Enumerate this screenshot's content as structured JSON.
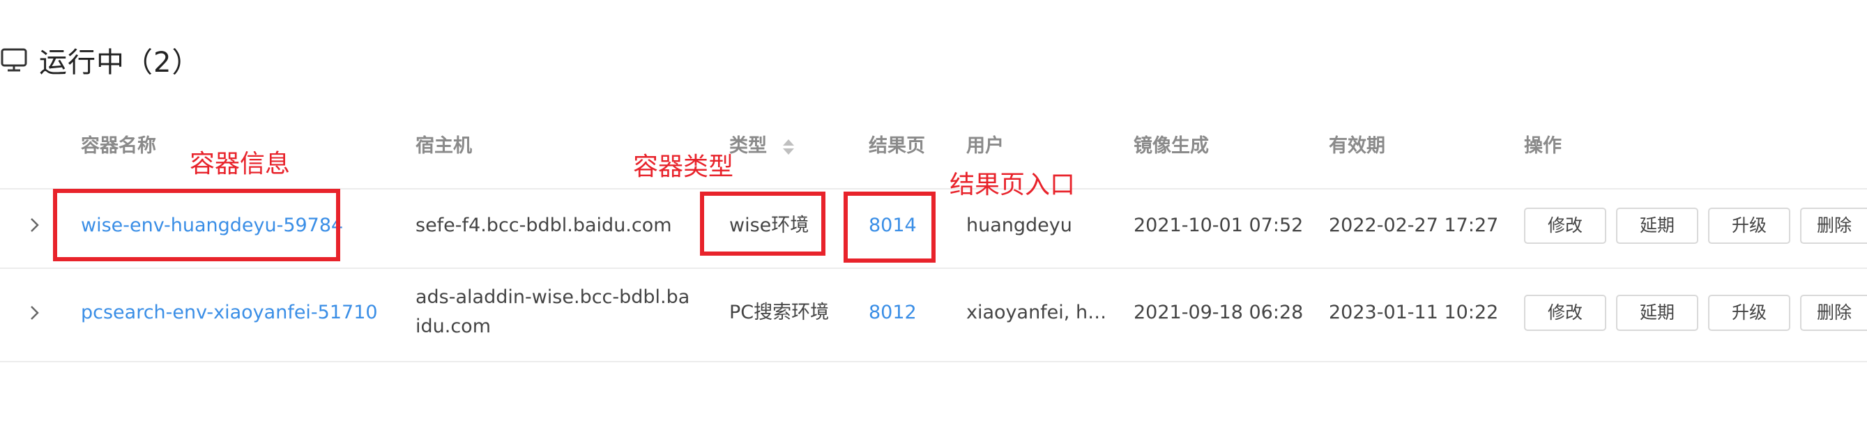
{
  "section": {
    "title": "运行中（2）",
    "icon": "monitor-icon"
  },
  "columns": {
    "name": "容器名称",
    "host": "宿主机",
    "type": "类型",
    "result": "结果页",
    "user": "用户",
    "image": "镜像生成",
    "expire": "有效期",
    "actions": "操作"
  },
  "rows": [
    {
      "name": "wise-env-huangdeyu-59784",
      "host": "sefe-f4.bcc-bdbl.baidu.com",
      "type": "wise环境",
      "result": "8014",
      "user": "huangdeyu",
      "image": "2021-10-01 07:52",
      "expire": "2022-02-27 17:27"
    },
    {
      "name": "pcsearch-env-xiaoyanfei-51710",
      "host": "ads-aladdin-wise.bcc-bdbl.baidu.com",
      "type": "PC搜索环境",
      "result": "8012",
      "user": "xiaoyanfei, h…",
      "image": "2021-09-18 06:28",
      "expire": "2023-01-11 10:22"
    }
  ],
  "buttons": {
    "edit": "修改",
    "extend": "延期",
    "upgrade": "升级",
    "delete": "删除"
  },
  "annotations": {
    "container_info": "容器信息",
    "container_type": "容器类型",
    "result_entry": "结果页入口"
  },
  "colors": {
    "link": "#3a8ee6",
    "annotation": "#e8232b"
  }
}
